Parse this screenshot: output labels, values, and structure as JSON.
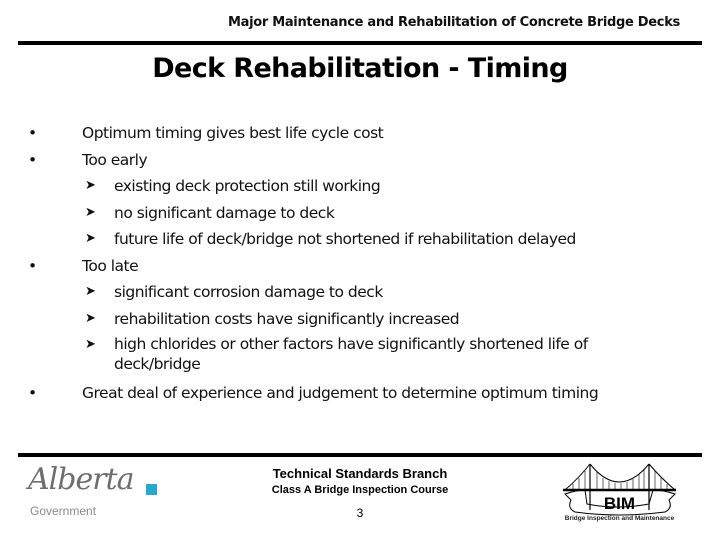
{
  "header": {
    "course_title": "Major Maintenance and Rehabilitation of Concrete Bridge Decks"
  },
  "slide": {
    "title": "Deck Rehabilitation - Timing",
    "bullets": [
      {
        "marker": "•",
        "text": "Optimum timing gives best life cycle cost"
      },
      {
        "marker": "•",
        "text": "Too early",
        "sub": [
          {
            "marker": "Ø",
            "text": "existing deck protection still working"
          },
          {
            "marker": "Ø",
            "text": "no significant damage to deck"
          },
          {
            "marker": "Ø",
            "text": "future life of deck/bridge not shortened if rehabilitation delayed"
          }
        ]
      },
      {
        "marker": "•",
        "text": "Too late",
        "sub": [
          {
            "marker": "Ø",
            "text": "significant corrosion damage to deck"
          },
          {
            "marker": "Ø",
            "text": "rehabilitation costs have significantly increased"
          },
          {
            "marker": "Ø",
            "text": "high chlorides or other factors have significantly shortened life of deck/bridge"
          }
        ]
      },
      {
        "marker": "•",
        "text": "Great deal of experience and judgement to determine optimum timing"
      }
    ]
  },
  "footer": {
    "organization": "Technical Standards Branch",
    "course": "Class A Bridge Inspection Course",
    "page_number": "3",
    "left_logo": {
      "name": "Alberta",
      "subtitle": "Government",
      "accent_color": "#2ba6cb"
    },
    "right_logo": {
      "acronym": "BIM",
      "caption": "Bridge Inspection and Maintenance"
    }
  }
}
